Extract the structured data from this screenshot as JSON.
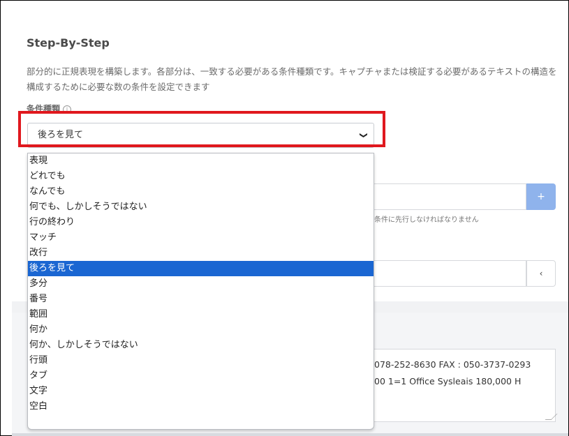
{
  "section": {
    "title": "Step-By-Step",
    "description": "部分的に正規表現を構築します。各部分は、一致する必要がある条件種類です。キャプチャまたは検証する必要があるテキストの構造を構成するために必要な数の条件を設定できます",
    "field_label": "条件種類",
    "info_glyph": "i"
  },
  "condition_select": {
    "value": "後ろを見て",
    "chevron": "❯",
    "options": [
      "表現",
      "どれでも",
      "なんでも",
      "何でも、しかしそうではない",
      "行の終わり",
      "マッチ",
      "改行",
      "後ろを見て",
      "多分",
      "番号",
      "範囲",
      "何か",
      "何か、しかしそうではない",
      "行頭",
      "タブ",
      "文字",
      "空白"
    ],
    "selected_index": 7
  },
  "add_button": {
    "label": "+"
  },
  "hint_text": "条件に先行しなければなりません",
  "back_button": {
    "label": "‹"
  },
  "sample_text": {
    "line1": "078-252-8630 FAX : 050-3737-0293",
    "line2": "00 1=1 Office Sysleais 180,000 H"
  },
  "colors": {
    "highlight": "#e0181e",
    "selected": "#1a66d2",
    "button": "#8fb3ec"
  }
}
